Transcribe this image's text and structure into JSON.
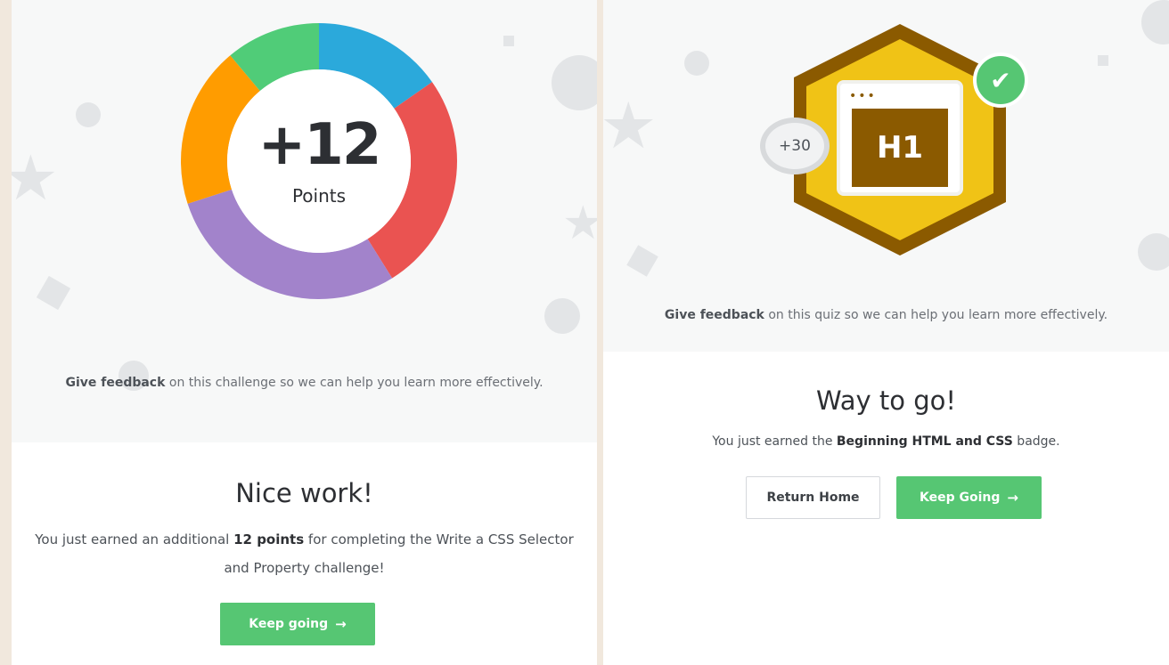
{
  "left_card": {
    "points_number": "+12",
    "points_label": "Points",
    "donut_segment_colors": [
      "#2ba9db",
      "#ea5351",
      "#a283cb",
      "#ff9c00",
      "#50cc78"
    ],
    "feedback_link": "Give feedback",
    "feedback_text": " on this challenge so we can help you learn more effectively.",
    "heading": "Nice work!",
    "message_prefix": "You just earned an additional ",
    "message_bold": "12 points",
    "message_suffix": " for completing the Write a CSS Selector and Property challenge!",
    "button_label": "Keep going",
    "button_arrow": "→"
  },
  "right_card": {
    "badge_title": "H1",
    "badge_window_dots": "•••",
    "badge_points": "+30",
    "check_icon": "✔",
    "feedback_link": "Give feedback",
    "feedback_text": " on this quiz so we can help you learn more effectively.",
    "heading": "Way to go!",
    "message_prefix": "You just earned the ",
    "message_bold": "Beginning HTML and CSS",
    "message_suffix": " badge.",
    "return_button": "Return Home",
    "keep_button": "Keep Going",
    "keep_arrow": "→"
  },
  "colors": {
    "accent_green": "#56c673",
    "badge_gold": "#f0c316",
    "badge_brown": "#8b5a00"
  }
}
